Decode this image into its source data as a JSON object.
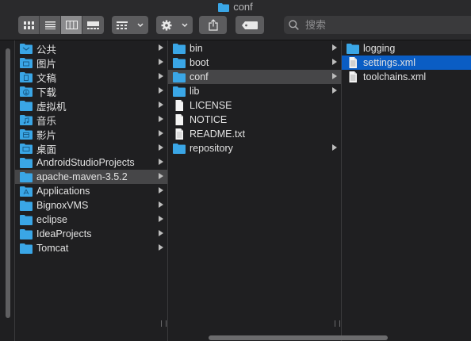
{
  "window": {
    "title": "conf"
  },
  "toolbar": {
    "view_buttons": [
      "icon-view",
      "list-view",
      "column-view",
      "gallery-view"
    ],
    "active_view": "column-view",
    "search_placeholder": "搜索"
  },
  "sidebar": {
    "items": [
      {
        "label": "公共",
        "icon": "public-folder-icon"
      },
      {
        "label": "图片",
        "icon": "pictures-folder-icon"
      },
      {
        "label": "文稿",
        "icon": "documents-folder-icon"
      },
      {
        "label": "下载",
        "icon": "downloads-folder-icon"
      },
      {
        "label": "虚拟机",
        "icon": "folder-icon"
      },
      {
        "label": "音乐",
        "icon": "music-folder-icon"
      },
      {
        "label": "影片",
        "icon": "movies-folder-icon"
      },
      {
        "label": "桌面",
        "icon": "desktop-folder-icon"
      },
      {
        "label": "AndroidStudioProjects",
        "icon": "folder-icon"
      },
      {
        "label": "apache-maven-3.5.2",
        "icon": "folder-icon",
        "selected": true
      },
      {
        "label": "Applications",
        "icon": "applications-folder-icon"
      },
      {
        "label": "BignoxVMS",
        "icon": "folder-icon"
      },
      {
        "label": "eclipse",
        "icon": "folder-icon"
      },
      {
        "label": "IdeaProjects",
        "icon": "folder-icon"
      },
      {
        "label": "Tomcat",
        "icon": "folder-icon"
      }
    ]
  },
  "column2": {
    "items": [
      {
        "label": "bin",
        "type": "folder"
      },
      {
        "label": "boot",
        "type": "folder"
      },
      {
        "label": "conf",
        "type": "folder",
        "selected": true
      },
      {
        "label": "lib",
        "type": "folder"
      },
      {
        "label": "LICENSE",
        "type": "file"
      },
      {
        "label": "NOTICE",
        "type": "file"
      },
      {
        "label": "README.txt",
        "type": "file"
      },
      {
        "label": "repository",
        "type": "folder"
      }
    ]
  },
  "column3": {
    "items": [
      {
        "label": "logging",
        "type": "folder"
      },
      {
        "label": "settings.xml",
        "type": "file",
        "selected": true
      },
      {
        "label": "toolchains.xml",
        "type": "file"
      }
    ]
  },
  "colors": {
    "folder_blue": "#3aa6e6",
    "selection_blue": "#0a5dc4",
    "selection_gray": "#464648"
  }
}
